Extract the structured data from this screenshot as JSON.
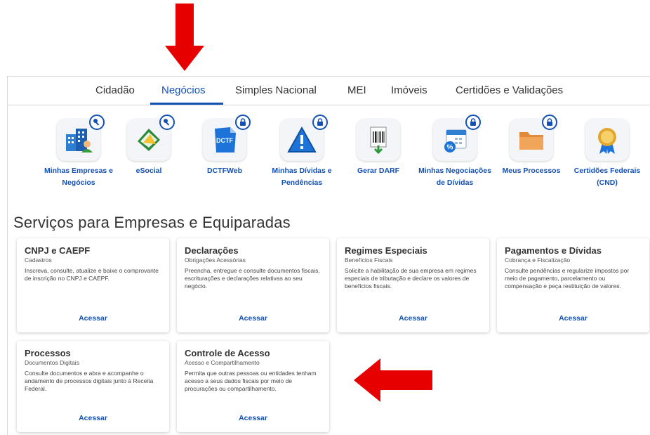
{
  "tabs": [
    {
      "label": "Cidadão"
    },
    {
      "label": "Negócios"
    },
    {
      "label": "Simples Nacional"
    },
    {
      "label": "MEI"
    },
    {
      "label": "Imóveis"
    },
    {
      "label": "Certidões e Validações"
    }
  ],
  "active_tab": "Negócios",
  "shortcuts": [
    {
      "label": "Minhas Empresas e Negócios",
      "icon": "buildings-icon",
      "badge": "key-icon"
    },
    {
      "label": "eSocial",
      "icon": "esocial-icon",
      "badge": "key-icon"
    },
    {
      "label": "DCTFWeb",
      "icon": "dctf-document-icon",
      "badge": "lock-icon"
    },
    {
      "label": "Minhas Dívidas e Pendências",
      "icon": "warning-icon",
      "badge": "lock-icon"
    },
    {
      "label": "Gerar DARF",
      "icon": "barcode-icon",
      "badge": ""
    },
    {
      "label": "Minhas Negociações de Dívidas",
      "icon": "calendar-percent-icon",
      "badge": "lock-icon"
    },
    {
      "label": "Meus Processos",
      "icon": "folder-icon",
      "badge": "lock-icon"
    },
    {
      "label": "Certidões Federais (CND)",
      "icon": "medal-icon",
      "badge": ""
    }
  ],
  "section_title": "Serviços para Empresas e Equiparadas",
  "cards": [
    {
      "title": "CNPJ e CAEPF",
      "subtitle": "Cadastros",
      "description": "Inscreva, consulte, atualize e baixe o comprovante de inscrição no CNPJ e CAEPF.",
      "button": "Acessar"
    },
    {
      "title": "Declarações",
      "subtitle": "Obrigações Acessórias",
      "description": "Preencha, entregue e consulte documentos fiscais, escriturações e declarações relativas ao seu negócio.",
      "button": "Acessar"
    },
    {
      "title": "Regimes Especiais",
      "subtitle": "Benefícios Fiscais",
      "description": "Solicite a habilitação de sua empresa em regimes especiais de tributação e declare os valores de benefícios fiscais.",
      "button": "Acessar"
    },
    {
      "title": "Pagamentos e Dívidas",
      "subtitle": "Cobrança e Fiscalização",
      "description": "Consulte pendências e regularize impostos por meio de pagamento, parcelamento ou compensação e peça restituição de valores.",
      "button": "Acessar"
    },
    {
      "title": "Processos",
      "subtitle": "Documentos Digitais",
      "description": "Consulte documentos e abra e acompanhe o andamento de processos digitais junto à Receita Federal.",
      "button": "Acessar"
    },
    {
      "title": "Controle de Acesso",
      "subtitle": "Acesso e Compartilhamento",
      "description": "Permita que outras pessoas ou entidades tenham acesso a seus dados fiscais por meio de procurações ou compartilhamento.",
      "button": "Acessar"
    }
  ],
  "colors": {
    "accent": "#1351b4",
    "arrow": "#e60000"
  }
}
